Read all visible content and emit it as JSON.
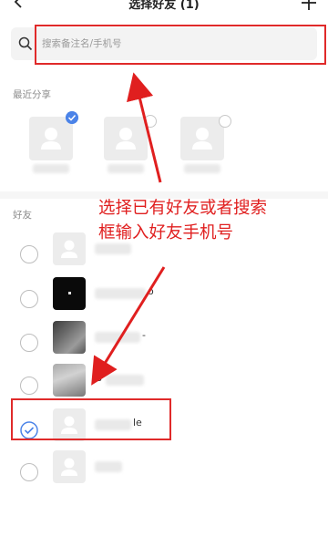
{
  "header": {
    "title": "选择好友 (1)",
    "back_icon": "chevron-left-icon",
    "add_icon": "plus-icon"
  },
  "search": {
    "icon": "search-icon",
    "placeholder": "搜索备注名/手机号",
    "value": ""
  },
  "recent": {
    "label": "最近分享",
    "items": [
      {
        "selected": true
      },
      {
        "selected": false
      },
      {
        "selected": false
      }
    ]
  },
  "friends": {
    "label": "好友",
    "items": [
      {
        "name_visible": "",
        "selected": false
      },
      {
        "name_visible": "o",
        "selected": false
      },
      {
        "name_visible": "-",
        "selected": false
      },
      {
        "name_visible": "s",
        "selected": false
      },
      {
        "name_visible": "le",
        "selected": true
      },
      {
        "name_visible": "",
        "selected": false
      }
    ]
  },
  "annotation": {
    "line1": "选择已有好友或者搜索",
    "line2": "框输入好友手机号",
    "color": "#e01f1f"
  },
  "colors": {
    "accent": "#4b83e8",
    "highlight": "#e02a2a"
  }
}
